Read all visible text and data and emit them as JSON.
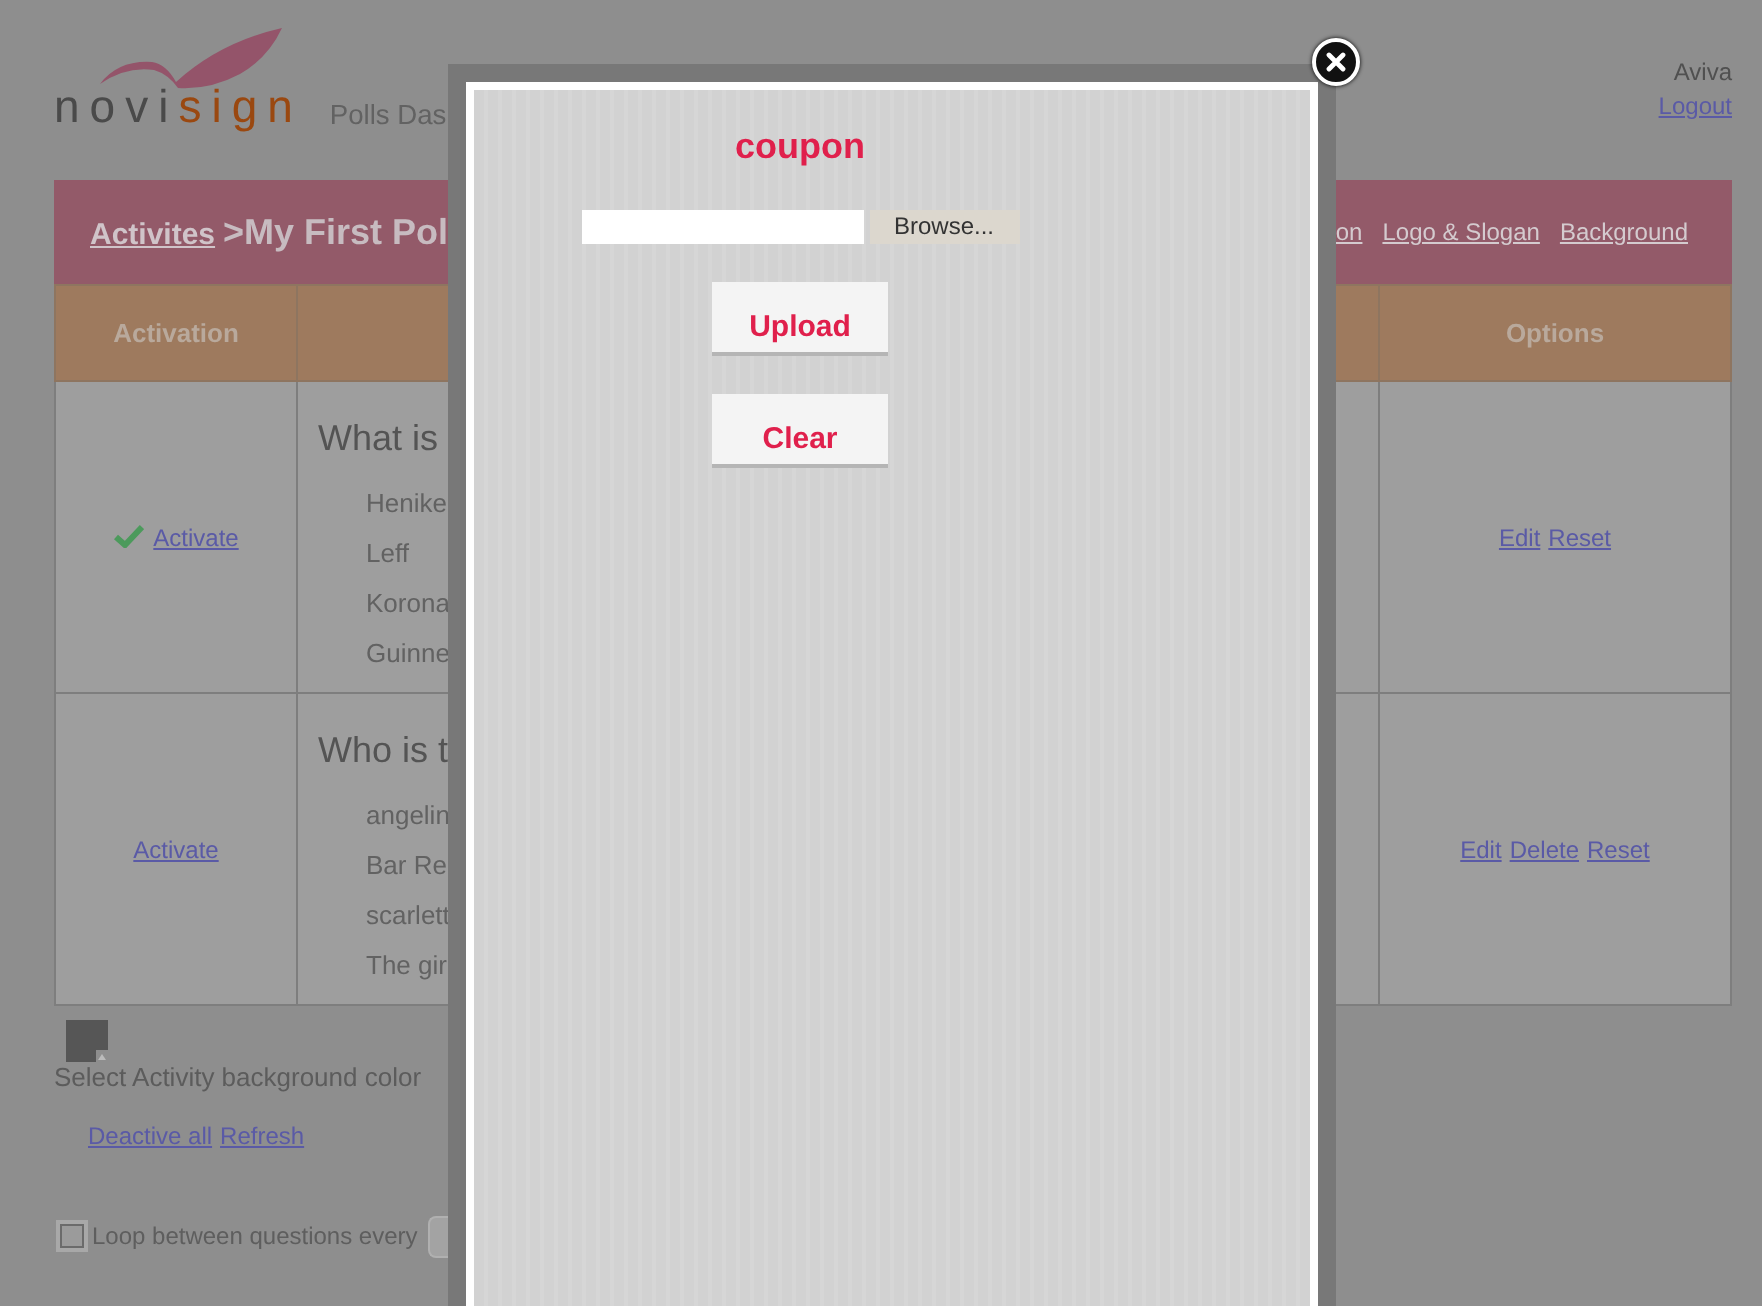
{
  "header": {
    "logo": {
      "dark_part": "novi",
      "accent_part": "sign"
    },
    "app_title": "Polls Das",
    "user_name": "Aviva",
    "logout_link": "Logout"
  },
  "title_bar": {
    "breadcrumb_link": "Activites",
    "page_title": ">My First Pol",
    "links": [
      "on",
      "Logo & Slogan",
      "Background"
    ]
  },
  "table": {
    "column_1": "Activation",
    "column_3": "Options",
    "rows": [
      {
        "active": true,
        "activate_link": "Activate",
        "question": "What is",
        "answers": [
          "Henike",
          "Leff",
          "Korona",
          "Guinne"
        ],
        "option_links": [
          "Edit",
          "Reset"
        ]
      },
      {
        "active": false,
        "activate_link": "Activate",
        "question": "Who is t",
        "answers": [
          "angelin",
          "Bar Re",
          "scarlett",
          "The gir"
        ],
        "option_links": [
          "Edit",
          "Delete",
          "Reset"
        ]
      }
    ]
  },
  "background_color": {
    "label": "Select Activity background color"
  },
  "actions": [
    "Deactive all",
    "Refresh"
  ],
  "loop": {
    "checked": false,
    "label": "Loop between questions every"
  },
  "modal": {
    "title": "coupon",
    "browse_button": "Browse...",
    "buttons": [
      "Upload",
      "Clear"
    ]
  }
}
